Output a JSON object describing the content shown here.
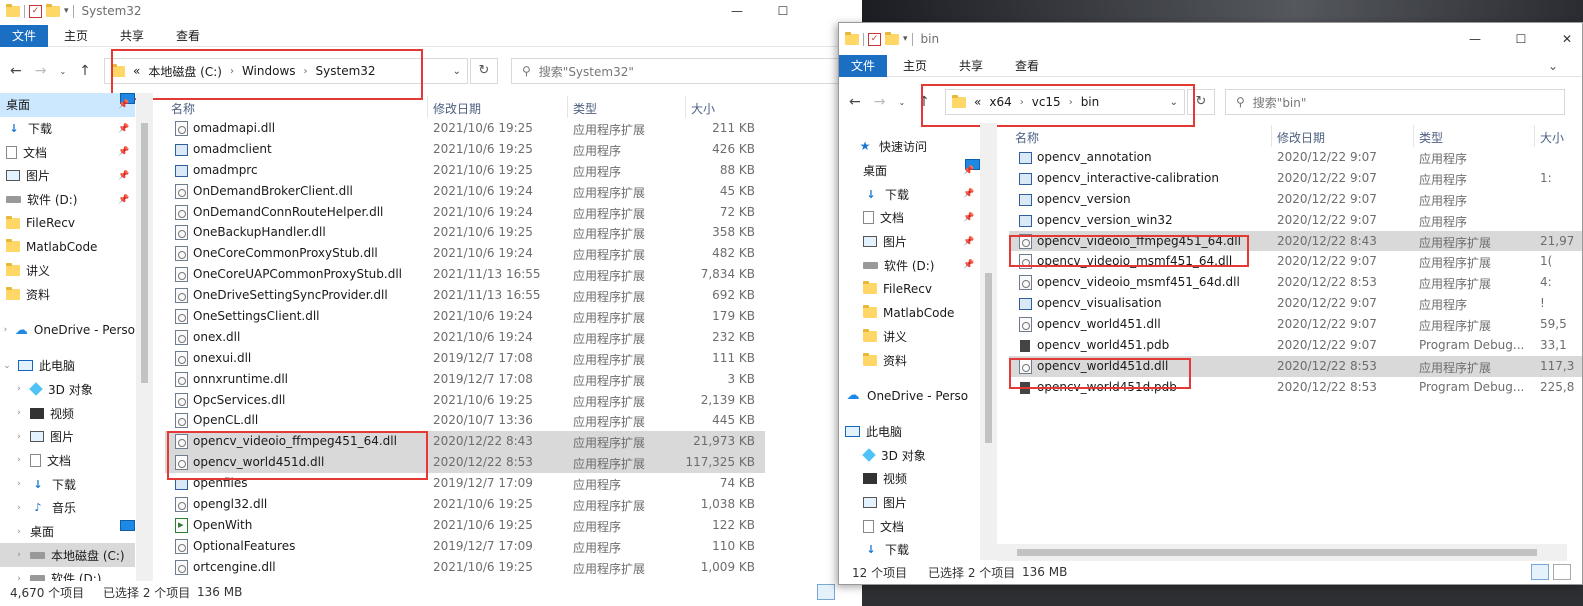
{
  "left": {
    "title": "System32",
    "ribbon": [
      "文件",
      "主页",
      "共享",
      "查看"
    ],
    "address": {
      "root": "«",
      "crumbs": [
        "本地磁盘 (C:)",
        "Windows",
        "System32"
      ]
    },
    "search_placeholder": "搜索\"System32\"",
    "nav": [
      {
        "label": "桌面",
        "icon": "desktop-icon",
        "pinned": true,
        "sel": "blue"
      },
      {
        "label": "下载",
        "icon": "download-icon",
        "pinned": true
      },
      {
        "label": "文档",
        "icon": "document-icon",
        "pinned": true
      },
      {
        "label": "图片",
        "icon": "picture-icon",
        "pinned": true
      },
      {
        "label": "软件 (D:)",
        "icon": "drive-icon",
        "pinned": true
      },
      {
        "label": "FileRecv",
        "icon": "folder-icon"
      },
      {
        "label": "MatlabCode",
        "icon": "folder-icon"
      },
      {
        "label": "讲义",
        "icon": "folder-icon"
      },
      {
        "label": "资料",
        "icon": "folder-icon"
      },
      {
        "label": "",
        "icon": "spacer"
      },
      {
        "label": "OneDrive - Perso",
        "icon": "cloud-icon",
        "exp": "›"
      },
      {
        "label": "",
        "icon": "spacer"
      },
      {
        "label": "此电脑",
        "icon": "pc-icon",
        "exp": "⌄"
      },
      {
        "label": "3D 对象",
        "icon": "3d-icon",
        "exp": "›",
        "indent": 1
      },
      {
        "label": "视频",
        "icon": "video-icon",
        "exp": "›",
        "indent": 1
      },
      {
        "label": "图片",
        "icon": "picture-icon",
        "exp": "›",
        "indent": 1
      },
      {
        "label": "文档",
        "icon": "document-icon",
        "exp": "›",
        "indent": 1
      },
      {
        "label": "下载",
        "icon": "download-icon",
        "exp": "›",
        "indent": 1
      },
      {
        "label": "音乐",
        "icon": "music-icon",
        "exp": "›",
        "indent": 1
      },
      {
        "label": "桌面",
        "icon": "desktop-icon",
        "exp": "›",
        "indent": 1
      },
      {
        "label": "本地磁盘 (C:)",
        "icon": "drive-icon",
        "exp": "›",
        "indent": 1,
        "sel": "grey"
      },
      {
        "label": "软件 (D:)",
        "icon": "drive-icon",
        "exp": "›",
        "indent": 1
      }
    ],
    "columns": [
      "名称",
      "修改日期",
      "类型",
      "大小"
    ],
    "files": [
      {
        "name": "omadmapi.dll",
        "date": "2021/10/6 19:25",
        "type": "应用程序扩展",
        "size": "211 KB",
        "icon": "dll"
      },
      {
        "name": "omadmclient",
        "date": "2021/10/6 19:25",
        "type": "应用程序",
        "size": "426 KB",
        "icon": "exe"
      },
      {
        "name": "omadmprc",
        "date": "2021/10/6 19:25",
        "type": "应用程序",
        "size": "88 KB",
        "icon": "exe"
      },
      {
        "name": "OnDemandBrokerClient.dll",
        "date": "2021/10/6 19:24",
        "type": "应用程序扩展",
        "size": "45 KB",
        "icon": "dll"
      },
      {
        "name": "OnDemandConnRouteHelper.dll",
        "date": "2021/10/6 19:24",
        "type": "应用程序扩展",
        "size": "72 KB",
        "icon": "dll"
      },
      {
        "name": "OneBackupHandler.dll",
        "date": "2021/10/6 19:25",
        "type": "应用程序扩展",
        "size": "358 KB",
        "icon": "dll"
      },
      {
        "name": "OneCoreCommonProxyStub.dll",
        "date": "2021/10/6 19:24",
        "type": "应用程序扩展",
        "size": "482 KB",
        "icon": "dll"
      },
      {
        "name": "OneCoreUAPCommonProxyStub.dll",
        "date": "2021/11/13 16:55",
        "type": "应用程序扩展",
        "size": "7,834 KB",
        "icon": "dll"
      },
      {
        "name": "OneDriveSettingSyncProvider.dll",
        "date": "2021/11/13 16:55",
        "type": "应用程序扩展",
        "size": "692 KB",
        "icon": "dll"
      },
      {
        "name": "OneSettingsClient.dll",
        "date": "2021/10/6 19:24",
        "type": "应用程序扩展",
        "size": "179 KB",
        "icon": "dll"
      },
      {
        "name": "onex.dll",
        "date": "2021/10/6 19:24",
        "type": "应用程序扩展",
        "size": "232 KB",
        "icon": "dll"
      },
      {
        "name": "onexui.dll",
        "date": "2019/12/7 17:08",
        "type": "应用程序扩展",
        "size": "111 KB",
        "icon": "dll"
      },
      {
        "name": "onnxruntime.dll",
        "date": "2019/12/7 17:08",
        "type": "应用程序扩展",
        "size": "3 KB",
        "icon": "dll"
      },
      {
        "name": "OpcServices.dll",
        "date": "2021/10/6 19:25",
        "type": "应用程序扩展",
        "size": "2,139 KB",
        "icon": "dll"
      },
      {
        "name": "OpenCL.dll",
        "date": "2020/10/7 13:36",
        "type": "应用程序扩展",
        "size": "445 KB",
        "icon": "dll"
      },
      {
        "name": "opencv_videoio_ffmpeg451_64.dll",
        "date": "2020/12/22 8:43",
        "type": "应用程序扩展",
        "size": "21,973 KB",
        "icon": "dll",
        "sel": true
      },
      {
        "name": "opencv_world451d.dll",
        "date": "2020/12/22 8:53",
        "type": "应用程序扩展",
        "size": "117,325 KB",
        "icon": "dll",
        "sel": true
      },
      {
        "name": "openfiles",
        "date": "2019/12/7 17:09",
        "type": "应用程序",
        "size": "74 KB",
        "icon": "exe"
      },
      {
        "name": "opengl32.dll",
        "date": "2021/10/6 19:25",
        "type": "应用程序扩展",
        "size": "1,038 KB",
        "icon": "dll"
      },
      {
        "name": "OpenWith",
        "date": "2021/10/6 19:25",
        "type": "应用程序",
        "size": "122 KB",
        "icon": "openwith"
      },
      {
        "name": "OptionalFeatures",
        "date": "2019/12/7 17:09",
        "type": "应用程序",
        "size": "110 KB",
        "icon": "gear"
      },
      {
        "name": "ortcengine.dll",
        "date": "2021/10/6 19:25",
        "type": "应用程序扩展",
        "size": "1,009 KB",
        "icon": "dll"
      }
    ],
    "status": {
      "count": "4,670 个项目",
      "selected": "已选择 2 个项目",
      "size": "136 MB"
    }
  },
  "right": {
    "title": "bin",
    "ribbon": [
      "文件",
      "主页",
      "共享",
      "查看"
    ],
    "address": {
      "root": "«",
      "crumbs": [
        "x64",
        "vc15",
        "bin"
      ]
    },
    "search_placeholder": "搜索\"bin\"",
    "nav": [
      {
        "label": "",
        "icon": "spacer"
      },
      {
        "label": "快速访问",
        "icon": "star-icon",
        "exp": ""
      },
      {
        "label": "桌面",
        "icon": "desktop-icon",
        "pinned": true,
        "indent": 1
      },
      {
        "label": "下载",
        "icon": "download-icon",
        "pinned": true,
        "indent": 1
      },
      {
        "label": "文档",
        "icon": "document-icon",
        "pinned": true,
        "indent": 1
      },
      {
        "label": "图片",
        "icon": "picture-icon",
        "pinned": true,
        "indent": 1
      },
      {
        "label": "软件 (D:)",
        "icon": "drive-icon",
        "pinned": true,
        "indent": 1
      },
      {
        "label": "FileRecv",
        "icon": "folder-icon",
        "indent": 1
      },
      {
        "label": "MatlabCode",
        "icon": "folder-icon",
        "indent": 1
      },
      {
        "label": "讲义",
        "icon": "folder-icon",
        "indent": 1
      },
      {
        "label": "资料",
        "icon": "folder-icon",
        "indent": 1
      },
      {
        "label": "",
        "icon": "spacer"
      },
      {
        "label": "OneDrive - Perso",
        "icon": "cloud-icon"
      },
      {
        "label": "",
        "icon": "spacer"
      },
      {
        "label": "此电脑",
        "icon": "pc-icon"
      },
      {
        "label": "3D 对象",
        "icon": "3d-icon",
        "indent": 1
      },
      {
        "label": "视频",
        "icon": "video-icon",
        "indent": 1
      },
      {
        "label": "图片",
        "icon": "picture-icon",
        "indent": 1
      },
      {
        "label": "文档",
        "icon": "document-icon",
        "indent": 1
      },
      {
        "label": "下载",
        "icon": "download-icon",
        "indent": 1
      }
    ],
    "columns": [
      "名称",
      "修改日期",
      "类型",
      "大小"
    ],
    "files": [
      {
        "name": "opencv_annotation",
        "date": "2020/12/22 9:07",
        "type": "应用程序",
        "size": "",
        "icon": "exe"
      },
      {
        "name": "opencv_interactive-calibration",
        "date": "2020/12/22 9:07",
        "type": "应用程序",
        "size": "1:",
        "icon": "exe"
      },
      {
        "name": "opencv_version",
        "date": "2020/12/22 9:07",
        "type": "应用程序",
        "size": "",
        "icon": "exe"
      },
      {
        "name": "opencv_version_win32",
        "date": "2020/12/22 9:07",
        "type": "应用程序",
        "size": "",
        "icon": "exe"
      },
      {
        "name": "opencv_videoio_ffmpeg451_64.dll",
        "date": "2020/12/22 8:43",
        "type": "应用程序扩展",
        "size": "21,97",
        "icon": "dll",
        "sel": true
      },
      {
        "name": "opencv_videoio_msmf451_64.dll",
        "date": "2020/12/22 9:07",
        "type": "应用程序扩展",
        "size": "1(",
        "icon": "dll"
      },
      {
        "name": "opencv_videoio_msmf451_64d.dll",
        "date": "2020/12/22 8:53",
        "type": "应用程序扩展",
        "size": "4:",
        "icon": "dll"
      },
      {
        "name": "opencv_visualisation",
        "date": "2020/12/22 9:07",
        "type": "应用程序",
        "size": "!",
        "icon": "exe"
      },
      {
        "name": "opencv_world451.dll",
        "date": "2020/12/22 9:07",
        "type": "应用程序扩展",
        "size": "59,5",
        "icon": "dll"
      },
      {
        "name": "opencv_world451.pdb",
        "date": "2020/12/22 9:07",
        "type": "Program Debug...",
        "size": "33,1",
        "icon": "pdb"
      },
      {
        "name": "opencv_world451d.dll",
        "date": "2020/12/22 8:53",
        "type": "应用程序扩展",
        "size": "117,3",
        "icon": "dll",
        "sel": true
      },
      {
        "name": "opencv_world451d.pdb",
        "date": "2020/12/22 8:53",
        "type": "Program Debug...",
        "size": "225,8",
        "icon": "pdb"
      }
    ],
    "status": {
      "count": "12 个项目",
      "selected": "已选择 2 个项目",
      "size": "136 MB"
    }
  },
  "window_buttons": {
    "min": "—",
    "max": "☐",
    "close": "✕"
  },
  "colors": {
    "ribbon_file": "#1a6fc2",
    "highlight_box": "#e53935",
    "selection": "#d9d9d9",
    "nav_selected": "#cce8ff"
  }
}
